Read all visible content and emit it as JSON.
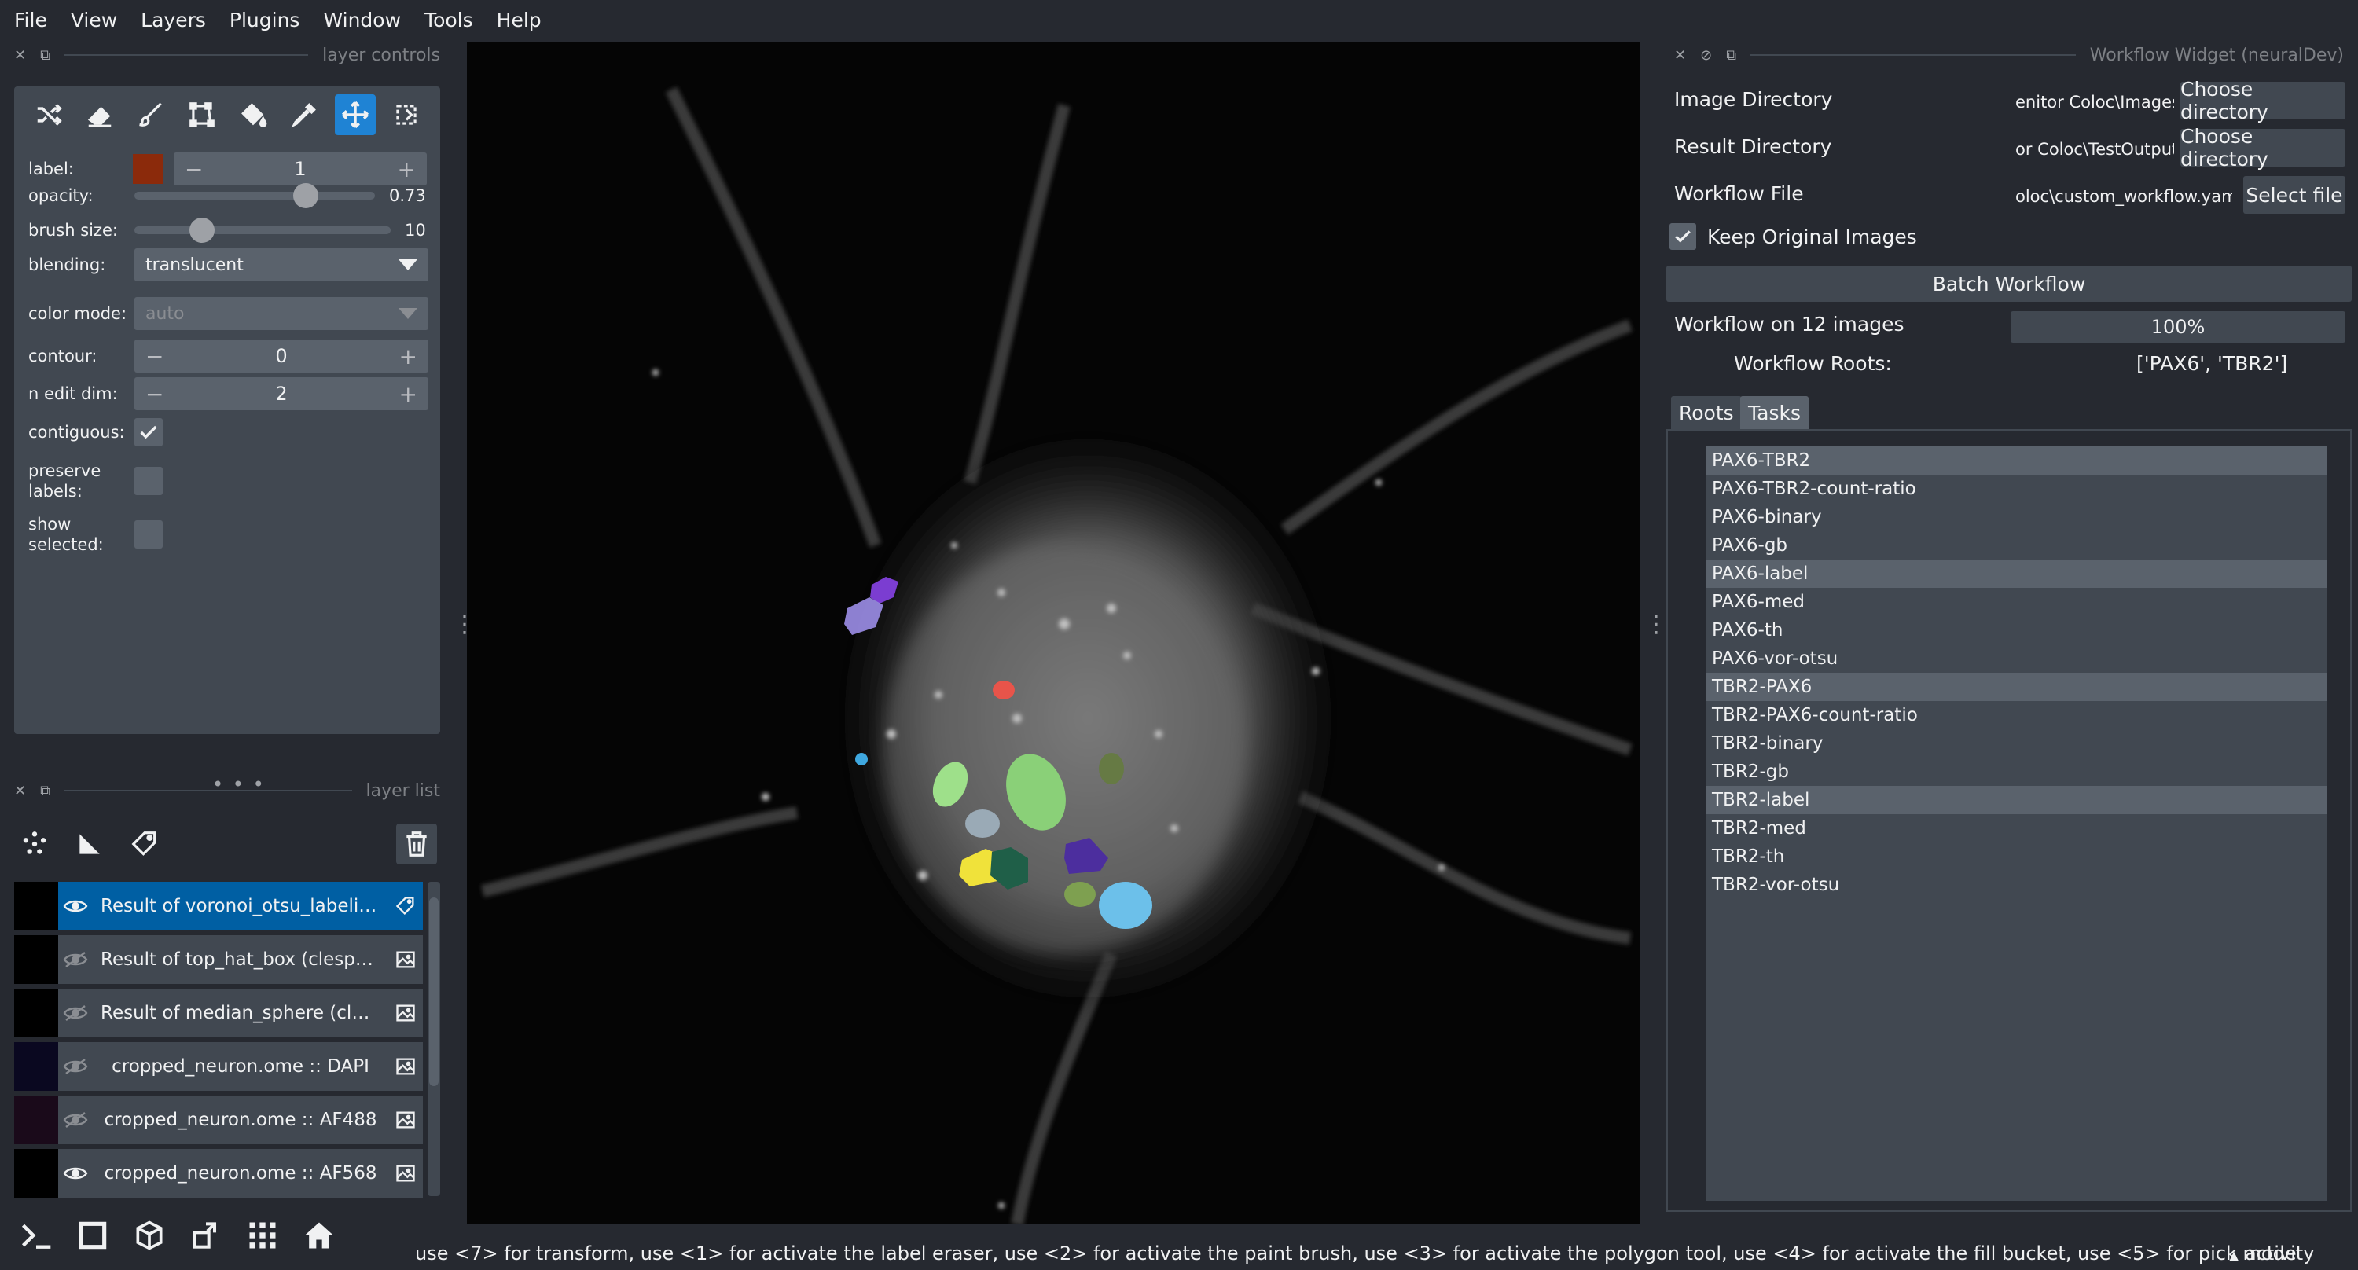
{
  "menu": [
    "File",
    "View",
    "Layers",
    "Plugins",
    "Window",
    "Tools",
    "Help"
  ],
  "layer_controls": {
    "title": "layer controls",
    "label": {
      "name": "label:",
      "value": "1",
      "color": "#8b2a0b"
    },
    "opacity": {
      "name": "opacity:",
      "value": "0.73",
      "fraction": 0.73
    },
    "brush_size": {
      "name": "brush size:",
      "value": "10"
    },
    "blending": {
      "name": "blending:",
      "value": "translucent"
    },
    "color_mode": {
      "name": "color mode:",
      "value": "auto"
    },
    "contour": {
      "name": "contour:",
      "value": "0"
    },
    "n_edit_dim": {
      "name": "n edit dim:",
      "value": "2"
    },
    "contiguous": {
      "name": "contiguous:",
      "checked": true
    },
    "preserve_labels": {
      "name": "preserve labels:",
      "checked": false
    },
    "show_selected": {
      "name": "show selected:",
      "checked": false
    }
  },
  "layer_list": {
    "title": "layer list",
    "layers": [
      {
        "name": "Result of voronoi_otsu_labelin...",
        "visible": true,
        "type": "labels",
        "selected": true
      },
      {
        "name": "Result of top_hat_box (clesper...",
        "visible": false,
        "type": "image",
        "selected": false
      },
      {
        "name": "Result of median_sphere (clesp...",
        "visible": false,
        "type": "image",
        "selected": false
      },
      {
        "name": "cropped_neuron.ome :: DAPI",
        "visible": false,
        "type": "image",
        "selected": false
      },
      {
        "name": "cropped_neuron.ome :: AF488",
        "visible": false,
        "type": "image",
        "selected": false
      },
      {
        "name": "cropped_neuron.ome :: AF568",
        "visible": true,
        "type": "image",
        "selected": false
      }
    ]
  },
  "workflow": {
    "title": "Workflow Widget (neuralDev)",
    "image_dir": {
      "label": "Image Directory",
      "path": "enitor Coloc\\Images",
      "button": "Choose directory"
    },
    "result_dir": {
      "label": "Result Directory",
      "path": "or Coloc\\TestOutput",
      "button": "Choose directory"
    },
    "workflow_file": {
      "label": "Workflow File",
      "path": "oloc\\custom_workflow.yaml",
      "button": "Select file"
    },
    "keep_original": {
      "label": "Keep Original Images",
      "checked": true
    },
    "batch_button": "Batch Workflow",
    "progress_label": "Workflow on 12 images",
    "progress_text": "100%",
    "progress_fraction": 1.0,
    "roots_label": "Workflow Roots:",
    "roots_value": "['PAX6', 'TBR2']",
    "tabs": [
      "Roots",
      "Tasks"
    ],
    "tasks": [
      {
        "name": "PAX6-TBR2",
        "hl": true
      },
      {
        "name": "PAX6-TBR2-count-ratio",
        "hl": false
      },
      {
        "name": "PAX6-binary",
        "hl": false
      },
      {
        "name": "PAX6-gb",
        "hl": false
      },
      {
        "name": "PAX6-label",
        "hl": true
      },
      {
        "name": "PAX6-med",
        "hl": false
      },
      {
        "name": "PAX6-th",
        "hl": false
      },
      {
        "name": "PAX6-vor-otsu",
        "hl": false
      },
      {
        "name": "TBR2-PAX6",
        "hl": true
      },
      {
        "name": "TBR2-PAX6-count-ratio",
        "hl": false
      },
      {
        "name": "TBR2-binary",
        "hl": false
      },
      {
        "name": "TBR2-gb",
        "hl": false
      },
      {
        "name": "TBR2-label",
        "hl": true
      },
      {
        "name": "TBR2-med",
        "hl": false
      },
      {
        "name": "TBR2-th",
        "hl": false
      },
      {
        "name": "TBR2-vor-otsu",
        "hl": false
      }
    ]
  },
  "status": {
    "text": "use <7> for transform, use <1> for activate the label eraser, use <2> for activate the paint brush, use <3> for activate the polygon tool, use <4> for activate the fill bucket, use <5> for pick mode",
    "activity": "activity"
  },
  "colors": {
    "accent": "#1f83d4",
    "selected_layer": "#005fa3",
    "panel": "#414851",
    "background": "#262930"
  }
}
